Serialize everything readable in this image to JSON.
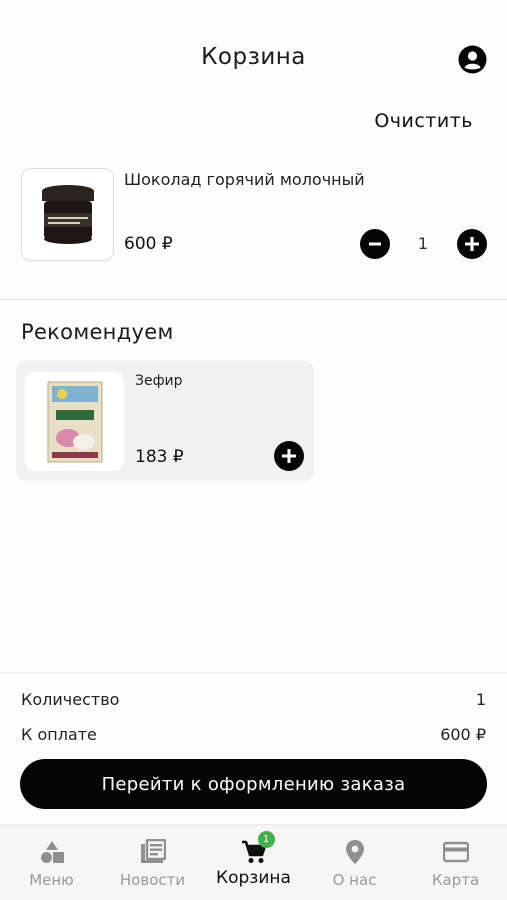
{
  "header": {
    "title": "Корзина"
  },
  "actions": {
    "clear_label": "Очистить"
  },
  "cart": {
    "items": [
      {
        "name": "Шоколад горячий молочный",
        "price": "600 ₽",
        "quantity": "1"
      }
    ]
  },
  "recommendations": {
    "title": "Рекомендуем",
    "items": [
      {
        "name": "Зефир",
        "price": "183 ₽"
      }
    ]
  },
  "summary": {
    "quantity_label": "Количество",
    "quantity_value": "1",
    "total_label": "К оплате",
    "total_value": "600 ₽",
    "checkout_label": "Перейти к оформлению заказа"
  },
  "nav": {
    "items": [
      {
        "label": "Меню",
        "icon": "menu-shapes-icon"
      },
      {
        "label": "Новости",
        "icon": "news-icon"
      },
      {
        "label": "Корзина",
        "icon": "cart-icon",
        "badge": "1",
        "active": true
      },
      {
        "label": "О нас",
        "icon": "location-pin-icon"
      },
      {
        "label": "Карта",
        "icon": "card-icon"
      }
    ]
  },
  "colors": {
    "accent": "#050505",
    "badge": "#3fb04a",
    "inactive": "#9a9a9a"
  }
}
